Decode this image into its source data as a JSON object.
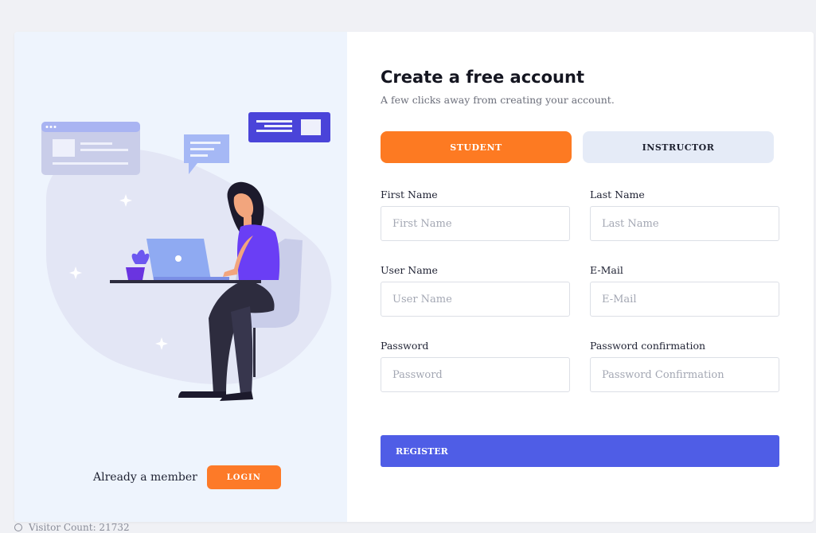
{
  "form": {
    "title": "Create a free account",
    "subtitle": "A few clicks away from creating your account.",
    "roles": {
      "student": "STUDENT",
      "instructor": "INSTRUCTOR"
    },
    "fields": {
      "first_name": {
        "label": "First Name",
        "placeholder": "First Name",
        "value": ""
      },
      "last_name": {
        "label": "Last Name",
        "placeholder": "Last Name",
        "value": ""
      },
      "user_name": {
        "label": "User Name",
        "placeholder": "User Name",
        "value": ""
      },
      "email": {
        "label": "E-Mail",
        "placeholder": "E-Mail",
        "value": ""
      },
      "password": {
        "label": "Password",
        "placeholder": "Password",
        "value": ""
      },
      "password_confirmation": {
        "label": "Password confirmation",
        "placeholder": "Password Confirmation",
        "value": ""
      }
    },
    "register_label": "REGISTER"
  },
  "aside": {
    "member_text": "Already a member",
    "login_label": "LOGIN"
  },
  "footer": {
    "visitor_text": "Visitor Count: 21732"
  },
  "colors": {
    "accent_orange": "#fd7a22",
    "accent_blue": "#4f5de6",
    "panel_bg": "#eef4fd",
    "illustration_purple": "#5b3ef5"
  },
  "icons": [
    "web-window-icon",
    "chat-bubble-icon",
    "message-card-icon",
    "sparkle-icon",
    "plant-icon",
    "laptop-icon"
  ]
}
